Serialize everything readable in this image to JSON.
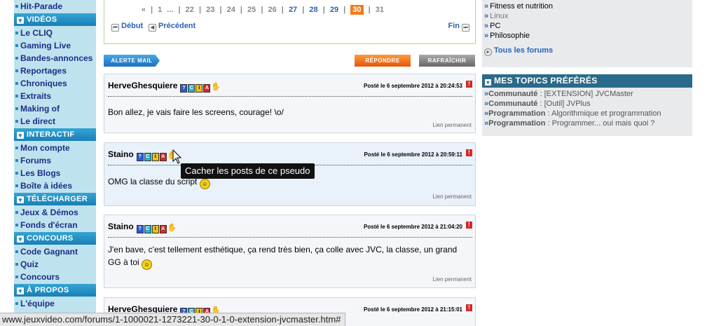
{
  "sidebar": {
    "items": [
      {
        "type": "item",
        "label": "Hit-Parade"
      },
      {
        "type": "header",
        "label": "Vidéos"
      },
      {
        "type": "item",
        "label": "Le CLIQ"
      },
      {
        "type": "item",
        "label": "Gaming Live"
      },
      {
        "type": "item",
        "label": "Bandes-annonces"
      },
      {
        "type": "item",
        "label": "Reportages"
      },
      {
        "type": "item",
        "label": "Chroniques"
      },
      {
        "type": "item",
        "label": "Extraits"
      },
      {
        "type": "item",
        "label": "Making of"
      },
      {
        "type": "item",
        "label": "Le direct"
      },
      {
        "type": "header",
        "label": "Interactif"
      },
      {
        "type": "item",
        "label": "Mon compte"
      },
      {
        "type": "item",
        "label": "Forums"
      },
      {
        "type": "item",
        "label": "Les Blogs"
      },
      {
        "type": "item",
        "label": "Boîte à idées"
      },
      {
        "type": "header",
        "label": "Télécharger"
      },
      {
        "type": "item",
        "label": "Jeux & Démos"
      },
      {
        "type": "item",
        "label": "Fonds d'écran"
      },
      {
        "type": "header",
        "label": "Concours"
      },
      {
        "type": "item",
        "label": "Code Gagnant"
      },
      {
        "type": "item",
        "label": "Quiz"
      },
      {
        "type": "item",
        "label": "Concours"
      },
      {
        "type": "header",
        "label": "À propos"
      },
      {
        "type": "item",
        "label": "L'équipe"
      }
    ]
  },
  "pager": {
    "first_sym": "«",
    "pages": [
      "1",
      "...",
      "22",
      "23",
      "24",
      "25",
      "26",
      "27",
      "28",
      "29",
      "30",
      "31"
    ],
    "current": "30",
    "debut": "Début",
    "precedent": "Précédent",
    "fin": "Fin"
  },
  "buttons": {
    "alert": "Alerte mail",
    "reply": "Répondre",
    "refresh": "Rafraîchir"
  },
  "posts": [
    {
      "author": "HerveGhesquiere",
      "date": "Posté le 6 septembre 2012 à 20:24:53",
      "message": "Bon allez, je vais faire les screens, courage! \\o/",
      "permalink": "Lien permanent"
    },
    {
      "author": "Staino",
      "date": "Posté le 6 septembre 2012 à 20:59:11",
      "message": "OMG la classe du script",
      "permalink": "Lien permanent"
    },
    {
      "author": "Staino",
      "date": "Posté le 6 septembre 2012 à 21:04:20",
      "message": "J'en bave, c'est tellement esthétique, ça rend très bien, ça colle avec JVC, la classe, un grand GG à toi",
      "permalink": "Lien permanent"
    },
    {
      "author": "HerveGhesquiere",
      "date": "Posté le 6 septembre 2012 à 21:15:01"
    }
  ],
  "tooltip": "Cacher les posts de ce pseudo",
  "right": {
    "forums": [
      "Fitness et nutrition",
      "Linux",
      "PC",
      "Philosophie"
    ],
    "all_forums": "Tous les forums",
    "topics_title": "MES TOPICS PRÉFÉRÉS",
    "topics": [
      {
        "category": "Communauté",
        "title": "[EXTENSION] JVCMaster"
      },
      {
        "category": "Communauté",
        "title": "[Outil] JVPlus"
      },
      {
        "category": "Programmation",
        "title": "Algorithmique et programmation"
      },
      {
        "category": "Programmation",
        "title": "Programmer... oui mais quoi ?"
      }
    ]
  },
  "statusbar": "www.jeuxvideo.com/forums/1-1000021-1273221-30-0-1-0-extension-jvcmaster.htm#",
  "colors": {
    "accent": "#f37a1c",
    "sidebar_bg": "#bfe3ee",
    "link": "#2a63b5",
    "header_blue": "#1a7fb5"
  }
}
